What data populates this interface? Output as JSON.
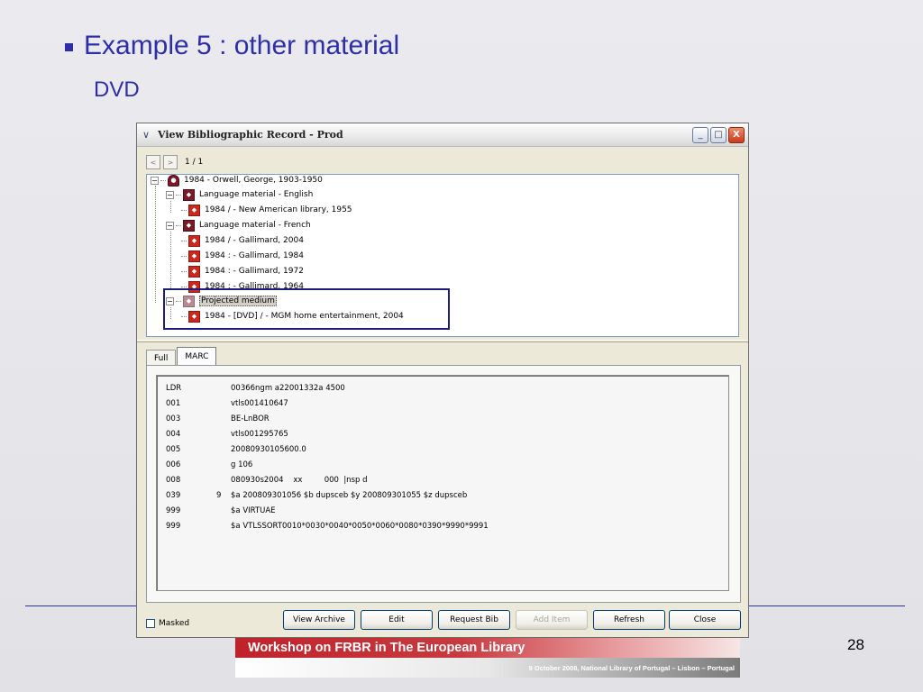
{
  "slide": {
    "title": "Example 5 : other material",
    "subtitle": "DVD",
    "page_number": "28",
    "footer_title": "Workshop on FRBR in The European Library",
    "footer_subtitle": "9 October 2008, National Library of Portugal – Lisbon – Portugal"
  },
  "window": {
    "title": "View Bibliographic Record - Prod",
    "controls": {
      "minimize": "_",
      "maximize": "□",
      "close": "X"
    }
  },
  "navigation": {
    "prev": "<",
    "next": ">",
    "count": "1 / 1"
  },
  "tree": {
    "work": "1984 - Orwell, George, 1903-1950",
    "groups": [
      {
        "label": "Language material - English",
        "items": [
          "1984 / - New American library, 1955"
        ]
      },
      {
        "label": "Language material - French",
        "items": [
          "1984 / - Gallimard, 2004",
          "1984 : - Gallimard, 1984",
          "1984 : - Gallimard, 1972",
          "1984 : - Gallimard, 1964"
        ]
      },
      {
        "label": "Projected medium",
        "items": [
          "1984 - [DVD] / - MGM home entertainment, 2004"
        ]
      }
    ]
  },
  "tabs": [
    "Full",
    "MARC"
  ],
  "marc": [
    {
      "tag": "LDR",
      "ind": "",
      "value": "00366ngm a22001332a 4500"
    },
    {
      "tag": "001",
      "ind": "",
      "value": "vtls001410647"
    },
    {
      "tag": "003",
      "ind": "",
      "value": "BE-LnBOR"
    },
    {
      "tag": "004",
      "ind": "",
      "value": "vtls001295765"
    },
    {
      "tag": "005",
      "ind": "",
      "value": "20080930105600.0"
    },
    {
      "tag": "006",
      "ind": "",
      "value": "g 106"
    },
    {
      "tag": "008",
      "ind": "",
      "value": "080930s2004    xx         000  |nsp d"
    },
    {
      "tag": "039",
      "ind": "9",
      "value": "$a 200809301056 $b dupsceb $y 200809301055 $z dupsceb"
    },
    {
      "tag": "999",
      "ind": "",
      "value": "$a VIRTUAE"
    },
    {
      "tag": "999",
      "ind": "",
      "value": "$a VTLSSORT0010*0030*0040*0050*0060*0080*0390*9990*9991"
    }
  ],
  "bottom": {
    "masked_label": "Masked",
    "buttons": [
      "View Archive",
      "Edit",
      "Request Bib",
      "Add Item",
      "Refresh",
      "Close"
    ]
  }
}
